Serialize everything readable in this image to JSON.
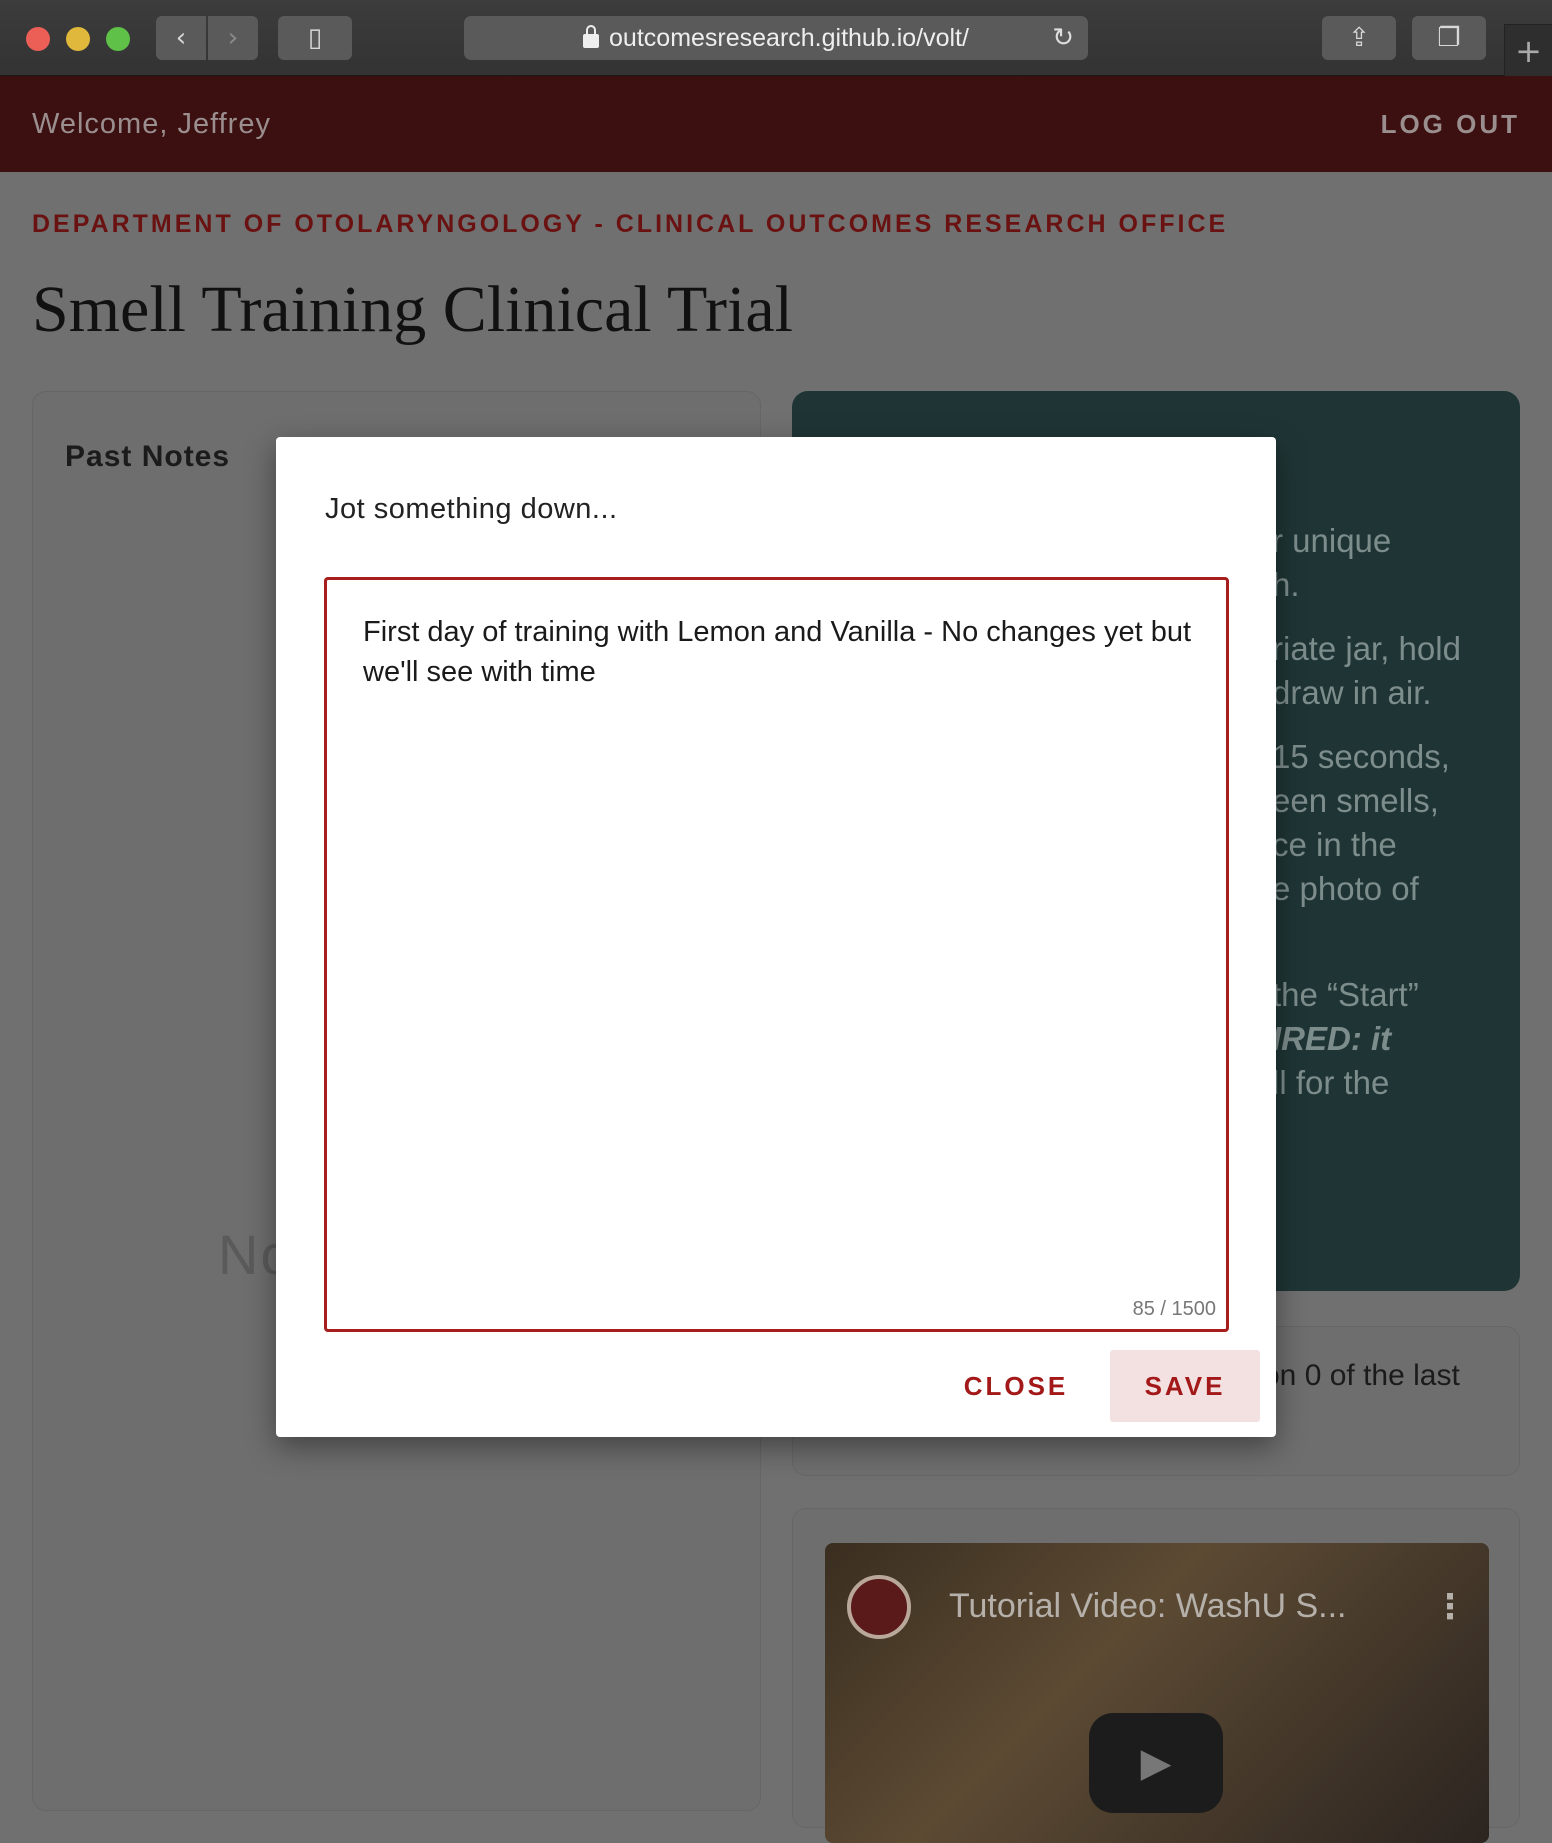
{
  "browser": {
    "url": "outcomesresearch.github.io/volt/"
  },
  "header": {
    "welcome": "Welcome, Jeffrey",
    "logout": "LOG OUT"
  },
  "page": {
    "department": "DEPARTMENT OF OTOLARYNGOLOGY - CLINICAL OUTCOMES RESEARCH OFFICE",
    "title": "Smell Training Clinical Trial"
  },
  "past_notes": {
    "heading": "Past Notes",
    "empty_text_fragment": "No"
  },
  "instructions_fragments": [
    "r unique",
    "h.",
    "riate jar, hold",
    "draw in air.",
    "15 seconds,",
    "een smells,",
    "ce in the",
    "e photo of",
    "the “Start”",
    "IRED: it",
    "ll for the"
  ],
  "progress_fragment": "on 0 of the last",
  "video": {
    "title": "Tutorial Video: WashU S..."
  },
  "dialog": {
    "title": "Jot something down...",
    "note_text": "First day of training with Lemon and Vanilla - No changes yet but we'll see with time",
    "counter": "85 / 1500",
    "close_label": "CLOSE",
    "save_label": "SAVE"
  }
}
